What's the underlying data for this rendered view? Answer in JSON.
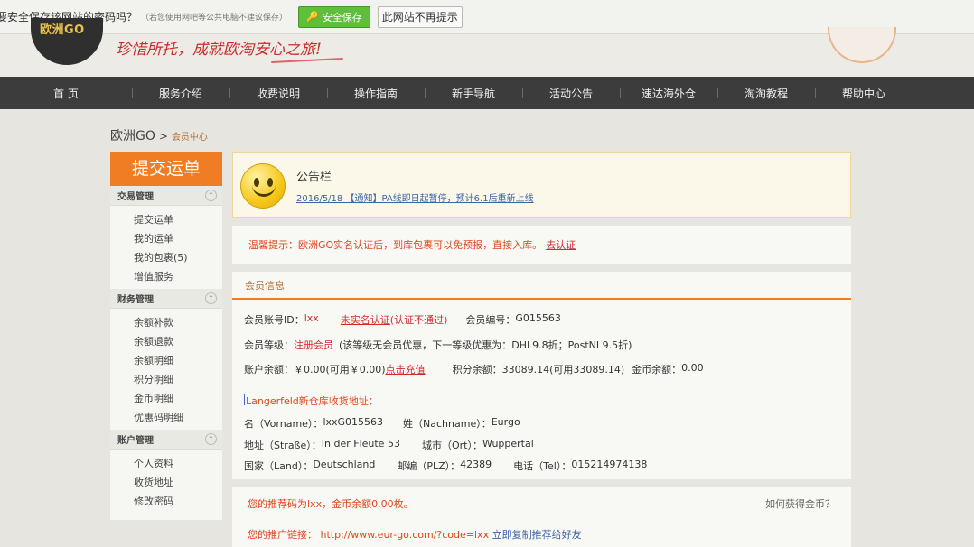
{
  "password_bar": {
    "question": "要安全保存该网站的密码吗？",
    "note": "（若您使用网吧等公共电脑不建议保存）",
    "save_label": "安全保存",
    "never_label": "此网站不再提示"
  },
  "header": {
    "logo_text": "欧洲GO",
    "slogan": "珍惜所托，成就欧淘安心之旅!"
  },
  "nav": {
    "items": [
      "首 页",
      "服务介绍",
      "收费说明",
      "操作指南",
      "新手导航",
      "活动公告",
      "速达海外仓",
      "淘淘教程",
      "帮助中心"
    ]
  },
  "breadcrumb": {
    "home": "欧洲GO",
    "arrow": ">",
    "current": "会员中心"
  },
  "sidebar": {
    "submit_label": "提交运单",
    "sections": [
      {
        "title": "交易管理",
        "items": [
          "提交运单",
          "我的运单",
          "我的包裹(5)",
          "增值服务"
        ]
      },
      {
        "title": "财务管理",
        "items": [
          "余额补款",
          "余额退款",
          "余额明细",
          "积分明细",
          "金币明细",
          "优惠码明细"
        ]
      },
      {
        "title": "账户管理",
        "items": [
          "个人资料",
          "收货地址",
          "修改密码"
        ]
      }
    ],
    "toggle_symbol": "⌃"
  },
  "notice": {
    "title": "公告栏",
    "link": "2016/5/18 【通知】PA线即日起暂停，预计6.1后重新上线"
  },
  "tip": {
    "text": "温馨提示：欧洲GO实名认证后，到库包裹可以免预报，直接入库。",
    "link": "去认证"
  },
  "member": {
    "heading": "会员信息",
    "account_label": "会员账号ID：",
    "account_value": "lxx",
    "realname_link": "未实名认证",
    "realname_status": "(认证不通过)",
    "number_label": "会员编号：",
    "number_value": "G015563",
    "level_label": "会员等级：",
    "level_value": "注册会员",
    "level_note": "(该等级无会员优惠，下一等级优惠为：DHL9.8折；PostNI 9.5折)",
    "balance_label": "账户余额：",
    "balance_value": "￥0.00(可用￥0.00)",
    "recharge_link": "点击充值",
    "points_label": "积分余额：",
    "points_value": "33089.14(可用33089.14)",
    "coins_label": "金币余额：",
    "coins_value": "0.00",
    "warehouse_title": "Langerfeld新仓库收货地址：",
    "vorname_label": "名（Vorname）：",
    "vorname_value": "lxxG015563",
    "nachname_label": "姓（Nachname）：",
    "nachname_value": "Eurgo",
    "strasse_label": "地址（Straße）：",
    "strasse_value": "In der Fleute 53",
    "ort_label": "城市（Ort）：",
    "ort_value": "Wuppertal",
    "land_label": "国家（Land）：",
    "land_value": "Deutschland",
    "plz_label": "邮编（PLZ）：",
    "plz_value": "42389",
    "tel_label": "电话（Tel）：",
    "tel_value": "015214974138"
  },
  "referral": {
    "code_text": "您的推荐码为lxx，金币余额0.00枚。",
    "how_link": "如何获得金币？",
    "link_label": "您的推广链接：",
    "link_value": "http://www.eur-go.com/?code=lxx",
    "copy_link": "立即复制推荐给好友"
  }
}
